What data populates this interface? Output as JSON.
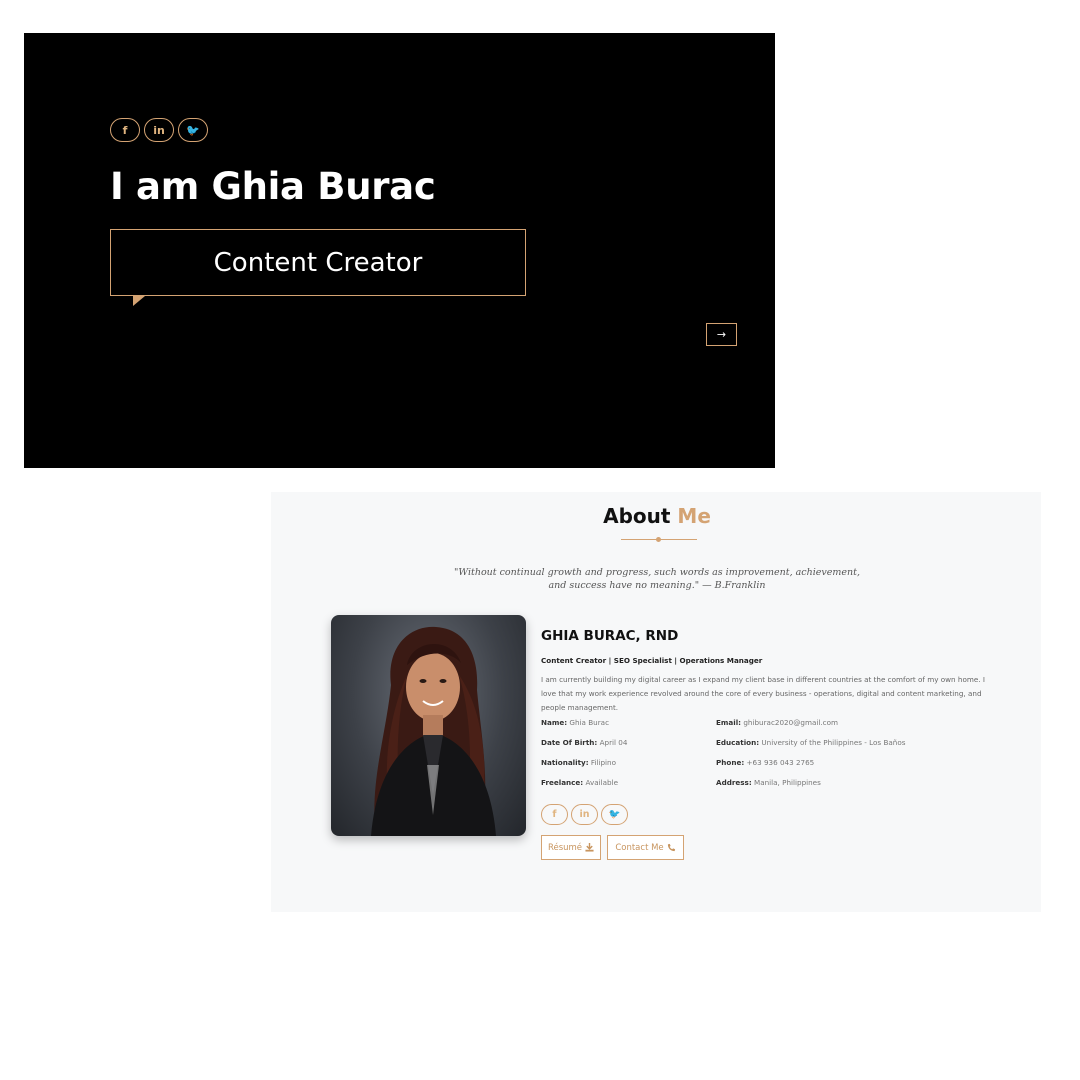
{
  "hero": {
    "social": [
      {
        "glyph": "f",
        "icon": "facebook-icon"
      },
      {
        "glyph": "in",
        "icon": "linkedin-icon"
      },
      {
        "glyph": "🐦",
        "icon": "twitter-icon"
      }
    ],
    "title": "I am Ghia Burac",
    "role": "Content Creator",
    "next_glyph": "→"
  },
  "about": {
    "heading_main": "About",
    "heading_accent": "Me",
    "quote_line1": "\"Without continual growth and progress, such words as improvement, achievement,",
    "quote_line2": "and success have no meaning.\" — B.Franklin",
    "name": "GHIA BURAC, RND",
    "roles": "Content Creator | SEO Specialist | Operations Manager",
    "bio": "I am currently building my digital career as I expand my client base in different countries at the comfort of my own home. I love that my work experience revolved around the core of every business - operations, digital and content marketing, and people management.",
    "details": {
      "name_label": "Name:",
      "name_value": "Ghia Burac",
      "dob_label": "Date Of Birth:",
      "dob_value": "April 04",
      "nationality_label": "Nationality:",
      "nationality_value": "Filipino",
      "freelance_label": "Freelance:",
      "freelance_value": "Available",
      "email_label": "Email:",
      "email_value": "ghiburac2020@gmail.com",
      "education_label": "Education:",
      "education_value": "University of the Philippines - Los Baños",
      "phone_label": "Phone:",
      "phone_value": "+63 936 043 2765",
      "address_label": "Address:",
      "address_value": "Manila, Philippines"
    },
    "resume_label": "Résumé",
    "resume_icon": "download-icon",
    "contact_label": "Contact Me",
    "contact_icon": "phone-icon"
  },
  "colors": {
    "accent": "#d4a373",
    "hero_bg": "#000000",
    "about_bg": "#f7f8f9"
  }
}
